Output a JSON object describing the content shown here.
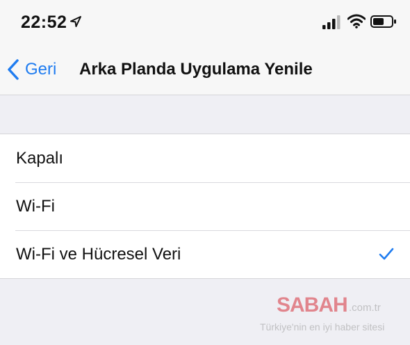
{
  "status_bar": {
    "time": "22:52",
    "icons": [
      "location-arrow-icon",
      "cellular-signal-icon",
      "wifi-icon",
      "battery-icon"
    ]
  },
  "nav_bar": {
    "back_label": "Geri",
    "title": "Arka Planda Uygulama Yenile"
  },
  "options": [
    {
      "label": "Kapalı",
      "selected": false
    },
    {
      "label": "Wi-Fi",
      "selected": false
    },
    {
      "label": "Wi-Fi ve Hücresel Veri",
      "selected": true
    }
  ],
  "watermark": {
    "brand": "SABAH",
    "domain": ".com.tr",
    "tagline": "Türkiye'nin en iyi haber sitesi"
  },
  "colors": {
    "accent": "#1f7cf0",
    "background": "#efeff4",
    "bar_background": "#f7f7f7",
    "cell_background": "#ffffff",
    "watermark_brand": "#d62f3a"
  }
}
